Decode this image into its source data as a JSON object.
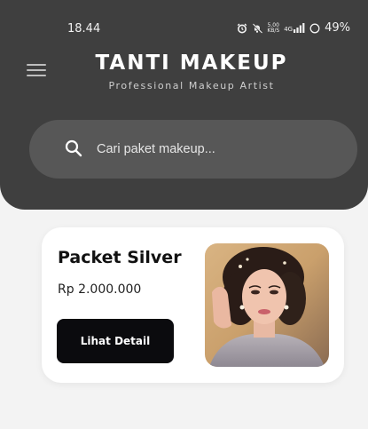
{
  "status_bar": {
    "time": "18.44",
    "net_speed_value": "5.00",
    "net_speed_unit": "KB/S",
    "network_label": "4G",
    "battery": "49%"
  },
  "header": {
    "title": "TANTI MAKEUP",
    "subtitle": "Professional Makeup Artist",
    "menu_icon": "hamburger-menu-icon"
  },
  "search": {
    "placeholder": "Cari paket makeup...",
    "icon": "search-icon"
  },
  "packages": [
    {
      "name": "Packet Silver",
      "price": "Rp 2.000.000",
      "button_label": "Lihat Detail"
    }
  ],
  "colors": {
    "header_bg": "#3f3f3f",
    "search_bg": "#575757",
    "page_bg": "#f3f3f3",
    "card_bg": "#ffffff",
    "button_bg": "#0b0b0e"
  }
}
